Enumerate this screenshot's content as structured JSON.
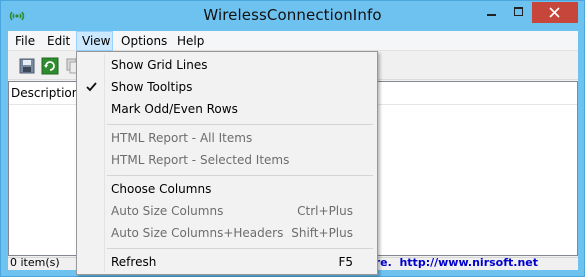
{
  "window": {
    "title": "WirelessConnectionInfo"
  },
  "menubar": {
    "items": [
      {
        "label": "File"
      },
      {
        "label": "Edit"
      },
      {
        "label": "View"
      },
      {
        "label": "Options"
      },
      {
        "label": "Help"
      }
    ]
  },
  "listview": {
    "columns": [
      {
        "label": "Description"
      }
    ]
  },
  "view_menu": {
    "items": [
      {
        "label": "Show Grid Lines",
        "shortcut": "",
        "checked": false,
        "enabled": true
      },
      {
        "label": "Show Tooltips",
        "shortcut": "",
        "checked": true,
        "enabled": true
      },
      {
        "label": "Mark Odd/Even Rows",
        "shortcut": "",
        "checked": false,
        "enabled": true
      },
      {
        "label": "HTML Report - All Items",
        "shortcut": "",
        "checked": false,
        "enabled": false
      },
      {
        "label": "HTML Report - Selected Items",
        "shortcut": "",
        "checked": false,
        "enabled": false
      },
      {
        "label": "Choose Columns",
        "shortcut": "",
        "checked": false,
        "enabled": true
      },
      {
        "label": "Auto Size Columns",
        "shortcut": "Ctrl+Plus",
        "checked": false,
        "enabled": false
      },
      {
        "label": "Auto Size Columns+Headers",
        "shortcut": "Shift+Plus",
        "checked": false,
        "enabled": false
      },
      {
        "label": "Refresh",
        "shortcut": "F5",
        "checked": false,
        "enabled": true
      }
    ]
  },
  "statusbar": {
    "item_count": "0 item(s)",
    "credit": "eware.  http://www.nirsoft.net"
  },
  "colors": {
    "titlebar": "#6ec2f0",
    "close_button": "#c7463c",
    "menu_highlight": "#cce8ff",
    "link": "#0000cc"
  }
}
